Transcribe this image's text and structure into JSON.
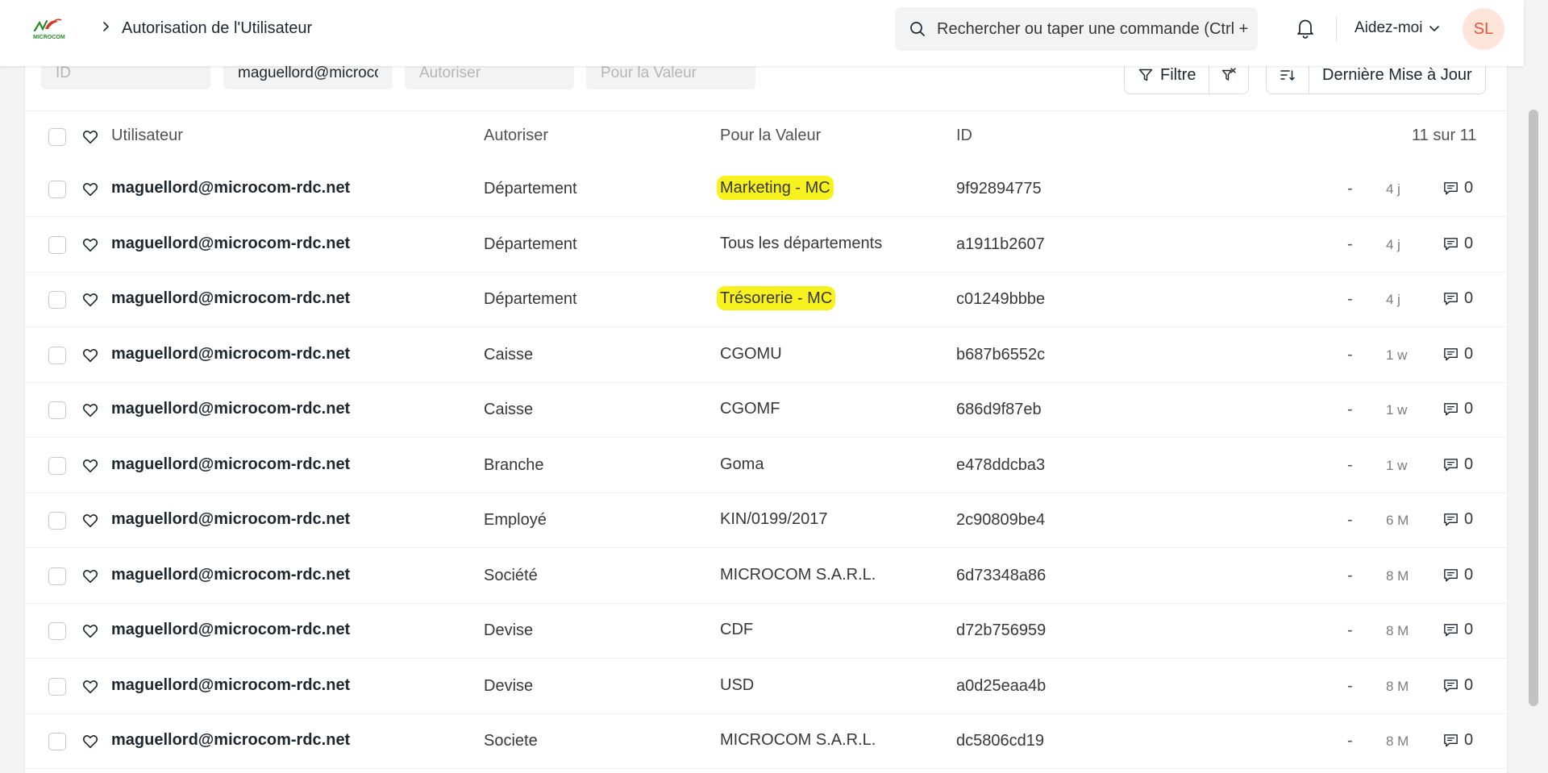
{
  "navbar": {
    "logo_text": "MICROCOM",
    "breadcrumb": "Autorisation de l'Utilisateur",
    "search_placeholder": "Rechercher ou taper une commande (Ctrl + G)",
    "help_label": "Aidez-moi",
    "avatar_initials": "SL"
  },
  "filters": {
    "id_placeholder": "ID",
    "user_value": "maguellord@microcom-rdc.net",
    "allow_placeholder": "Autoriser",
    "for_value_placeholder": "Pour la Valeur",
    "filter_label": "Filtre",
    "sort_label": "Dernière Mise à Jour"
  },
  "list": {
    "columns": {
      "user": "Utilisateur",
      "allow": "Autoriser",
      "for_value": "Pour la Valeur",
      "id": "ID"
    },
    "count": "11 sur 11",
    "rows": [
      {
        "user": "maguellord@microcom-rdc.net",
        "allow": "Département",
        "for_value": "Marketing - MC",
        "id": "9f92894775",
        "status": "-",
        "modified": "4 j",
        "comments": "0",
        "highlighted": true
      },
      {
        "user": "maguellord@microcom-rdc.net",
        "allow": "Département",
        "for_value": "Tous les départements",
        "id": "a1911b2607",
        "status": "-",
        "modified": "4 j",
        "comments": "0",
        "highlighted": false
      },
      {
        "user": "maguellord@microcom-rdc.net",
        "allow": "Département",
        "for_value": "Trésorerie - MC",
        "id": "c01249bbbe",
        "status": "-",
        "modified": "4 j",
        "comments": "0",
        "highlighted": true
      },
      {
        "user": "maguellord@microcom-rdc.net",
        "allow": "Caisse",
        "for_value": "CGOMU",
        "id": "b687b6552c",
        "status": "-",
        "modified": "1 w",
        "comments": "0",
        "highlighted": false
      },
      {
        "user": "maguellord@microcom-rdc.net",
        "allow": "Caisse",
        "for_value": "CGOMF",
        "id": "686d9f87eb",
        "status": "-",
        "modified": "1 w",
        "comments": "0",
        "highlighted": false
      },
      {
        "user": "maguellord@microcom-rdc.net",
        "allow": "Branche",
        "for_value": "Goma",
        "id": "e478ddcba3",
        "status": "-",
        "modified": "1 w",
        "comments": "0",
        "highlighted": false
      },
      {
        "user": "maguellord@microcom-rdc.net",
        "allow": "Employé",
        "for_value": "KIN/0199/2017",
        "id": "2c90809be4",
        "status": "-",
        "modified": "6 M",
        "comments": "0",
        "highlighted": false
      },
      {
        "user": "maguellord@microcom-rdc.net",
        "allow": "Société",
        "for_value": "MICROCOM S.A.R.L.",
        "id": "6d73348a86",
        "status": "-",
        "modified": "8 M",
        "comments": "0",
        "highlighted": false
      },
      {
        "user": "maguellord@microcom-rdc.net",
        "allow": "Devise",
        "for_value": "CDF",
        "id": "d72b756959",
        "status": "-",
        "modified": "8 M",
        "comments": "0",
        "highlighted": false
      },
      {
        "user": "maguellord@microcom-rdc.net",
        "allow": "Devise",
        "for_value": "USD",
        "id": "a0d25eaa4b",
        "status": "-",
        "modified": "8 M",
        "comments": "0",
        "highlighted": false
      },
      {
        "user": "maguellord@microcom-rdc.net",
        "allow": "Societe",
        "for_value": "MICROCOM S.A.R.L.",
        "id": "dc5806cd19",
        "status": "-",
        "modified": "8 M",
        "comments": "0",
        "highlighted": false
      }
    ]
  },
  "colors": {
    "highlight": "#f7f21e",
    "avatar_bg": "#fde5da",
    "avatar_text": "#e1553a"
  }
}
